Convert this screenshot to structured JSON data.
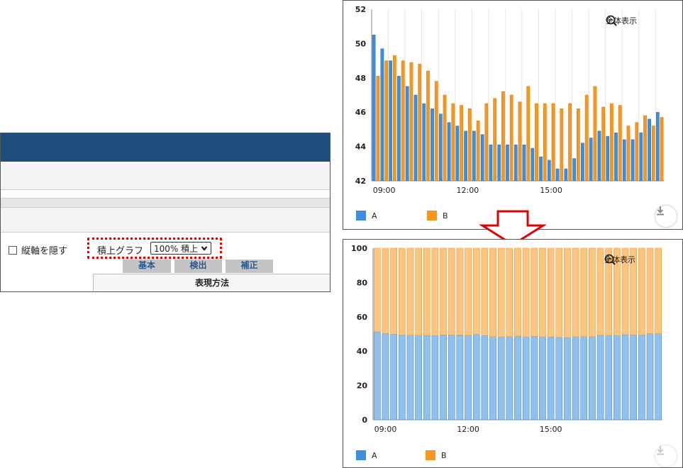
{
  "settings_panel": {
    "hide_axis_label": "縦軸を隠す",
    "stack_graph_label": "積上グラフ",
    "stack_select_value": "100% 積上",
    "tabs": [
      "基本",
      "検出",
      "補正"
    ],
    "column_header": "表現方法"
  },
  "zoom_label": "全体表示",
  "colors": {
    "A": "#3a8fdf",
    "B": "#f7971e",
    "A_light": "#8fc0ee",
    "B_light": "#fdc57e"
  },
  "chart_data": [
    {
      "type": "bar",
      "title": "",
      "ylim": [
        42,
        52
      ],
      "yticks": [
        "42",
        "44",
        "46",
        "48",
        "50",
        "52"
      ],
      "xticks": [
        "09:00",
        "12:00",
        "15:00"
      ],
      "legend": [
        "A",
        "B"
      ],
      "legend_position": "bottom-left",
      "series": [
        {
          "name": "A",
          "values": [
            50.5,
            49.7,
            49.0,
            48.1,
            47.5,
            47.0,
            46.5,
            46.2,
            45.9,
            45.4,
            45.2,
            44.9,
            44.9,
            44.7,
            44.1,
            44.1,
            44.1,
            44.1,
            44.1,
            43.9,
            43.4,
            43.2,
            42.7,
            42.7,
            43.3,
            44.2,
            44.5,
            44.9,
            44.6,
            44.8,
            44.4,
            44.4,
            44.8,
            45.6,
            46.0
          ]
        },
        {
          "name": "B",
          "values": [
            48.1,
            49.0,
            49.3,
            49.0,
            48.9,
            48.8,
            48.4,
            47.8,
            47.0,
            46.5,
            46.4,
            46.2,
            45.5,
            46.5,
            46.8,
            47.2,
            47.0,
            46.6,
            47.5,
            46.5,
            46.5,
            46.5,
            46.2,
            46.5,
            46.2,
            47.0,
            47.5,
            46.3,
            46.5,
            46.4,
            45.2,
            45.4,
            45.8,
            45.2,
            45.7
          ]
        }
      ]
    },
    {
      "type": "bar",
      "title": "",
      "stacked": "100%",
      "ylim": [
        0,
        100
      ],
      "yticks": [
        "0",
        "20",
        "40",
        "60",
        "80",
        "100"
      ],
      "xticks": [
        "09:00",
        "12:00",
        "15:00"
      ],
      "legend": [
        "A",
        "B"
      ],
      "legend_position": "bottom-left",
      "series": [
        {
          "name": "A",
          "values": [
            51.2,
            50.3,
            49.8,
            49.5,
            49.3,
            49.1,
            49.0,
            49.1,
            49.4,
            49.4,
            49.4,
            49.3,
            49.7,
            49.0,
            48.5,
            48.3,
            48.5,
            48.7,
            48.1,
            48.6,
            48.3,
            48.2,
            48.0,
            47.9,
            48.4,
            48.5,
            48.4,
            49.2,
            49.0,
            49.1,
            49.6,
            49.4,
            49.5,
            50.2,
            50.2
          ]
        },
        {
          "name": "B",
          "values": [
            48.8,
            49.7,
            50.2,
            50.5,
            50.7,
            50.9,
            51.0,
            50.9,
            50.6,
            50.6,
            50.6,
            50.7,
            50.3,
            51.0,
            51.5,
            51.7,
            51.5,
            51.3,
            51.9,
            51.4,
            51.7,
            51.8,
            52.0,
            52.1,
            51.6,
            51.5,
            51.6,
            50.8,
            51.0,
            50.9,
            50.4,
            50.6,
            50.5,
            49.8,
            49.8
          ]
        }
      ]
    }
  ]
}
